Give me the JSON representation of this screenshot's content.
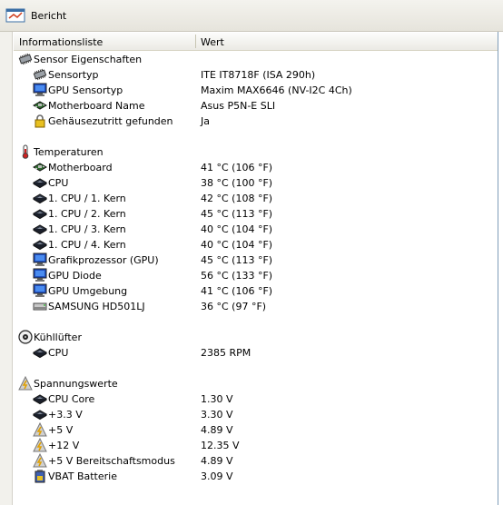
{
  "window": {
    "title": "Bericht"
  },
  "columns": {
    "name": "Informationsliste",
    "value": "Wert"
  },
  "groups": [
    {
      "title": "Sensor Eigenschaften",
      "icon": "sensor-chip-icon",
      "items": [
        {
          "label": "Sensortyp",
          "value": "ITE IT8718F  (ISA 290h)",
          "icon": "chip-icon"
        },
        {
          "label": "GPU Sensortyp",
          "value": "Maxim MAX6646  (NV-I2C 4Ch)",
          "icon": "monitor-icon"
        },
        {
          "label": "Motherboard Name",
          "value": "Asus P5N-E SLI",
          "icon": "motherboard-icon"
        },
        {
          "label": "Gehäusezutritt gefunden",
          "value": "Ja",
          "icon": "lock-icon"
        }
      ]
    },
    {
      "title": "Temperaturen",
      "icon": "thermometer-icon",
      "items": [
        {
          "label": "Motherboard",
          "value": "41 °C  (106 °F)",
          "icon": "motherboard-icon"
        },
        {
          "label": "CPU",
          "value": "38 °C  (100 °F)",
          "icon": "cpu-icon"
        },
        {
          "label": "1. CPU / 1. Kern",
          "value": "42 °C  (108 °F)",
          "icon": "cpu-icon"
        },
        {
          "label": "1. CPU / 2. Kern",
          "value": "45 °C  (113 °F)",
          "icon": "cpu-icon"
        },
        {
          "label": "1. CPU / 3. Kern",
          "value": "40 °C  (104 °F)",
          "icon": "cpu-icon"
        },
        {
          "label": "1. CPU / 4. Kern",
          "value": "40 °C  (104 °F)",
          "icon": "cpu-icon"
        },
        {
          "label": "Grafikprozessor (GPU)",
          "value": "45 °C  (113 °F)",
          "icon": "monitor-icon"
        },
        {
          "label": "GPU Diode",
          "value": "56 °C  (133 °F)",
          "icon": "monitor-icon"
        },
        {
          "label": "GPU Umgebung",
          "value": "41 °C  (106 °F)",
          "icon": "monitor-icon"
        },
        {
          "label": "SAMSUNG HD501LJ",
          "value": "36 °C  (97 °F)",
          "icon": "harddisk-icon"
        }
      ]
    },
    {
      "title": "Kühllüfter",
      "icon": "fan-icon",
      "items": [
        {
          "label": "CPU",
          "value": "2385 RPM",
          "icon": "cpu-icon"
        }
      ]
    },
    {
      "title": "Spannungswerte",
      "icon": "voltage-warning-icon",
      "items": [
        {
          "label": "CPU Core",
          "value": "1.30 V",
          "icon": "cpu-icon"
        },
        {
          "label": "+3.3 V",
          "value": "3.30 V",
          "icon": "cpu-icon"
        },
        {
          "label": "+5 V",
          "value": "4.89 V",
          "icon": "voltage-icon"
        },
        {
          "label": "+12 V",
          "value": "12.35 V",
          "icon": "voltage-icon"
        },
        {
          "label": "+5 V Bereitschaftsmodus",
          "value": "4.89 V",
          "icon": "voltage-icon"
        },
        {
          "label": "VBAT Batterie",
          "value": "3.09 V",
          "icon": "battery-icon"
        }
      ]
    }
  ]
}
